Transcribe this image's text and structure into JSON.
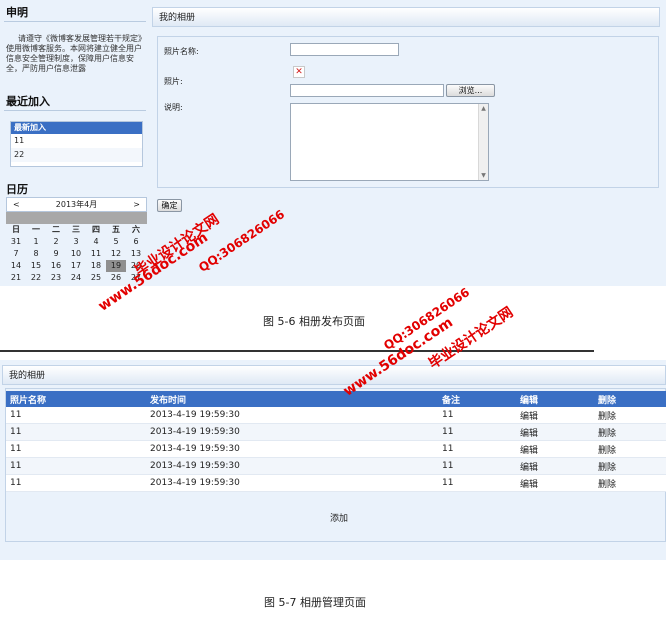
{
  "sidebar": {
    "notice_title": "申明",
    "notice_text": "请遵守《微博客发展管理若干规定》使用微博客服务。本网将建立健全用户信息安全管理制度，保障用户信息安全，严防用户信息泄露",
    "recent_title": "最近加入",
    "recent_header": "最新加入",
    "recent_items": [
      "11",
      "22"
    ],
    "calendar_title": "日历",
    "calendar": {
      "prev": "<",
      "next": ">",
      "month": "2013年4月",
      "weekdays": [
        "日",
        "一",
        "二",
        "三",
        "四",
        "五",
        "六"
      ],
      "weeks": [
        [
          "31",
          "1",
          "2",
          "3",
          "4",
          "5",
          "6"
        ],
        [
          "7",
          "8",
          "9",
          "10",
          "11",
          "12",
          "13"
        ],
        [
          "14",
          "15",
          "16",
          "17",
          "18",
          "19",
          "20"
        ],
        [
          "21",
          "22",
          "23",
          "24",
          "25",
          "26",
          "27"
        ]
      ],
      "today": "19"
    }
  },
  "album_form": {
    "title": "我的相册",
    "photo_name_label": "照片名称:",
    "photo_label": "照片:",
    "broken_image_glyph": "✕",
    "browse_button": "浏览...",
    "desc_label": "说明:",
    "submit_button": "确定",
    "caption": "图 5-6 相册发布页面"
  },
  "album_manage": {
    "title": "我的相册",
    "columns": [
      "照片名称",
      "发布时间",
      "备注",
      "编辑",
      "删除"
    ],
    "rows": [
      [
        "11",
        "2013-4-19  19:59:30",
        "11",
        "编辑",
        "删除"
      ],
      [
        "11",
        "2013-4-19  19:59:30",
        "11",
        "编辑",
        "删除"
      ],
      [
        "11",
        "2013-4-19  19:59:30",
        "11",
        "编辑",
        "删除"
      ],
      [
        "11",
        "2013-4-19  19:59:30",
        "11",
        "编辑",
        "删除"
      ],
      [
        "11",
        "2013-4-19  19:59:30",
        "11",
        "编辑",
        "删除"
      ]
    ],
    "add_link": "添加",
    "caption": "图 5-7 相册管理页面"
  },
  "watermarks": {
    "site": "www.56doc.com",
    "brand": "毕业设计论文网",
    "qq": "QQ:306826066",
    "color": "#e20000"
  },
  "colors": {
    "header_blue": "#3a6fc4",
    "panel_bg": "#eaf2fb"
  }
}
